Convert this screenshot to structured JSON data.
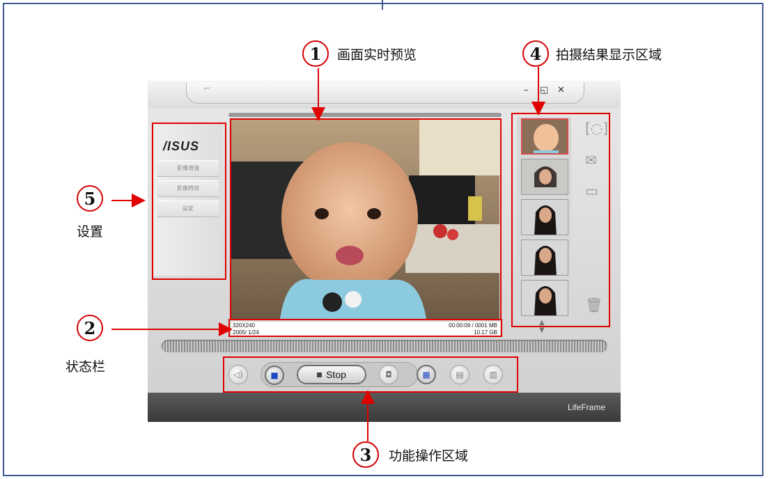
{
  "callouts": {
    "c1": {
      "num": "1",
      "label": "画面实时预览"
    },
    "c2": {
      "num": "2",
      "label": "状态栏"
    },
    "c3": {
      "num": "3",
      "label": "功能操作区域"
    },
    "c4": {
      "num": "4",
      "label": "拍摄结果显示区域"
    },
    "c5": {
      "num": "5",
      "label": "设置"
    }
  },
  "app": {
    "brand": "LifeFrame",
    "logo": "/ISUS",
    "window_controls": {
      "minimize": "–",
      "restore": "◱",
      "close": "✕"
    },
    "menu_tab_icon": "⌐",
    "sidebar_items": [
      "影像增強",
      "影像特效",
      "設定"
    ],
    "status": {
      "resolution": "320X240",
      "date": "2005/ 1/24",
      "duration_size": "00:00:09 / 0001 MB",
      "free_space": "10.17 GB"
    },
    "controls": {
      "stop_label": "Stop",
      "buttons": [
        "speaker-icon",
        "video-camera-icon",
        "stop-button",
        "camera-icon",
        "film-icon",
        "image-settings-icon",
        "auto-icon"
      ]
    },
    "side_icons": [
      "capture-frame-icon",
      "email-icon",
      "folder-icon",
      "trash-icon"
    ]
  },
  "colors": {
    "callout_red": "#e00000",
    "frame_blue": "#3f5a93",
    "active_blue": "#1f47c2"
  }
}
